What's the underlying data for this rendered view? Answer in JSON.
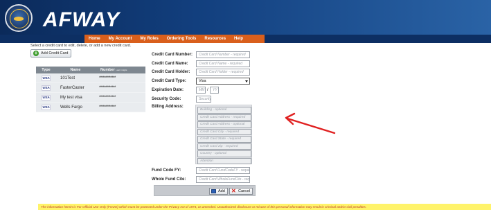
{
  "header": {
    "brand": "AFWAY"
  },
  "nav": {
    "items": [
      "Home",
      "My Account",
      "My Roles",
      "Ordering Tools",
      "Resources",
      "Help"
    ]
  },
  "instructions": "Select a credit card to edit, delete, or add a new credit card.",
  "add_button_label": "Add Credit Card",
  "cards_table": {
    "headers": {
      "type": "Type",
      "name": "Name",
      "number": "Number",
      "number_sup": "Last 4 digits"
    },
    "rows": [
      {
        "type": "VISA",
        "name": "101Test",
        "number": "*************"
      },
      {
        "type": "VISA",
        "name": "FasterCaster",
        "number": "*************"
      },
      {
        "type": "VISA",
        "name": "My test visa",
        "number": "*************"
      },
      {
        "type": "VISA",
        "name": "Wells Fargo",
        "number": "*************"
      }
    ]
  },
  "form": {
    "labels": {
      "number": "Credit Card Number:",
      "name": "Credit Card Name:",
      "holder": "Credit Card Holder:",
      "type": "Credit Card Type:",
      "expiration": "Expiration Date:",
      "security": "Security Code:",
      "billing": "Billing Address:",
      "fund_code": "Fund Code FY:",
      "whole_fund": "Whole Fund Cite:"
    },
    "placeholders": {
      "number": "Credit Card Number - required",
      "name": "Credit Card Name - required",
      "holder": "Credit Card Holder - required",
      "exp_month": "MM",
      "exp_year": "YY",
      "security": "Security",
      "fund_code": "Credit Card FundCodeFY - required",
      "whole_fund": "Credit Card WholeFundCite - required"
    },
    "type_value": "Visa",
    "expiration_separator": "/",
    "billing_placeholders": [
      "Building - optional",
      "Credit Card Address - required",
      "Credit Card Address - optional",
      "Credit Card City - required",
      "Credit Card State - required",
      "Credit Card Zip - required",
      "Country - optional",
      "Attention"
    ]
  },
  "actions": {
    "add": "Add",
    "cancel": "Cancel"
  },
  "footer": {
    "text": "The information herein is For Official Use Only (FOUO) which must be protected under the Privacy Act of 1974, as amended. Unauthorized disclosure or misuse of this personal information may result in criminal and/or civil penalties."
  },
  "colors": {
    "header_dark": "#0b2a5a",
    "nav_orange": "#d95f1c",
    "arrow_red": "#e02020",
    "footer_yellow": "#fff36a"
  }
}
